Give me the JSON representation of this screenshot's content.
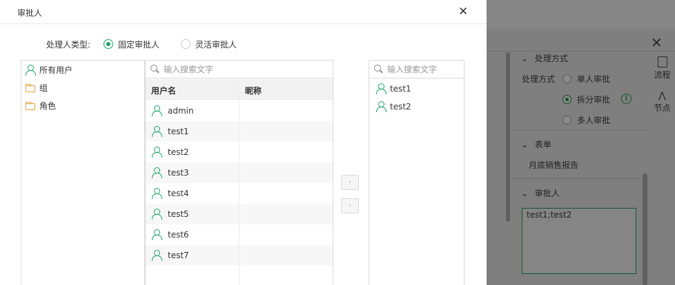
{
  "dialog": {
    "title": "审批人",
    "close_icon": "close-icon",
    "handler_type": {
      "label": "处理人类型:",
      "options": [
        "固定审批人",
        "灵活审批人"
      ],
      "selected": "固定审批人"
    }
  },
  "tree": {
    "items": [
      {
        "label": "所有用户",
        "icon": "user-icon"
      },
      {
        "label": "组",
        "icon": "folder-icon"
      },
      {
        "label": "角色",
        "icon": "folder-icon"
      }
    ]
  },
  "user_list": {
    "search_placeholder": "输入搜索文字",
    "columns": [
      "用户名",
      "昵称"
    ],
    "rows": [
      {
        "username": "admin",
        "nickname": ""
      },
      {
        "username": "test1",
        "nickname": ""
      },
      {
        "username": "test2",
        "nickname": ""
      },
      {
        "username": "test3",
        "nickname": ""
      },
      {
        "username": "test4",
        "nickname": ""
      },
      {
        "username": "test5",
        "nickname": ""
      },
      {
        "username": "test6",
        "nickname": ""
      },
      {
        "username": "test7",
        "nickname": ""
      }
    ]
  },
  "transfer": {
    "add_label": "›",
    "remove_label": "‹"
  },
  "selected_list": {
    "search_placeholder": "输入搜索文字",
    "items": [
      "test1",
      "test2"
    ]
  },
  "background_panel": {
    "section_processing": "处理方式",
    "processing_label": "处理方式",
    "processing_options": [
      "单人审批",
      "拆分审批",
      "多人审批"
    ],
    "processing_selected": "拆分审批",
    "info_icon": "i",
    "section_form": "表单",
    "form_value": "月底销售报告",
    "section_approver": "审批人",
    "approver_value": "test1;test2",
    "side_tabs": [
      "流程",
      "节点"
    ]
  },
  "colors": {
    "accent": "#1aa564",
    "folder": "#e6a13a",
    "overlay": "#7f7f7f"
  }
}
